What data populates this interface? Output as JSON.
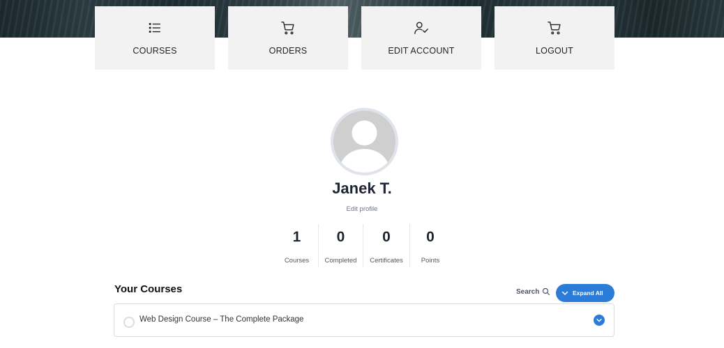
{
  "nav": {
    "tiles": [
      {
        "label": "COURSES",
        "icon": "list-icon"
      },
      {
        "label": "ORDERS",
        "icon": "cart-icon"
      },
      {
        "label": "EDIT ACCOUNT",
        "icon": "user-check-icon"
      },
      {
        "label": "LOGOUT",
        "icon": "cart-icon"
      }
    ]
  },
  "profile": {
    "name": "Janek T.",
    "edit_label": "Edit profile"
  },
  "stats": [
    {
      "value": "1",
      "label": "Courses"
    },
    {
      "value": "0",
      "label": "Completed"
    },
    {
      "value": "0",
      "label": "Certificates"
    },
    {
      "value": "0",
      "label": "Points"
    }
  ],
  "courses": {
    "heading": "Your Courses",
    "search_label": "Search",
    "expand_label": "Expand All",
    "items": [
      {
        "title": "Web Design Course – The Complete Package"
      }
    ]
  },
  "colors": {
    "accent": "#2b7bd8",
    "tile_bg": "#f2f2f2",
    "text_dark": "#1f2433"
  }
}
